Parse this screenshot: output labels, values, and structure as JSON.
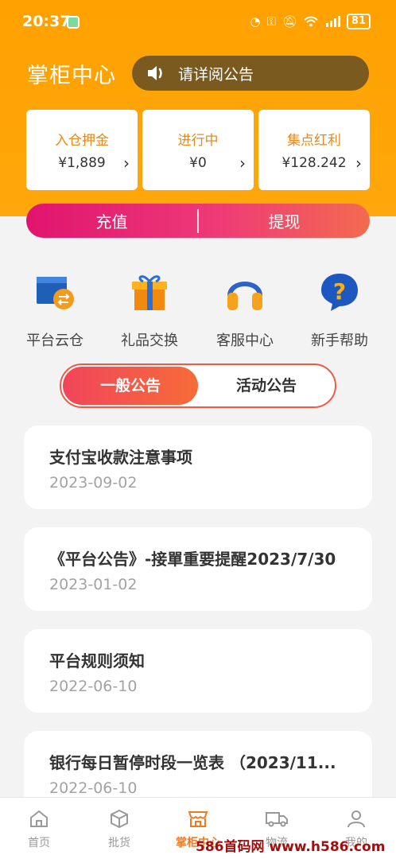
{
  "status_bar": {
    "time": "20:37",
    "battery": "81"
  },
  "header": {
    "title": "掌柜中心",
    "notice_text": "请详阅公告"
  },
  "stats": [
    {
      "label": "入仓押金",
      "value": "¥1,889"
    },
    {
      "label": "进行中",
      "value": "¥0"
    },
    {
      "label": "集点红利",
      "value": "¥128.242"
    }
  ],
  "actions": {
    "recharge": "充值",
    "withdraw": "提现"
  },
  "shortcuts": [
    {
      "label": "平台云仓",
      "icon": "cloud-warehouse-icon"
    },
    {
      "label": "礼品交换",
      "icon": "gift-icon"
    },
    {
      "label": "客服中心",
      "icon": "headphones-icon"
    },
    {
      "label": "新手帮助",
      "icon": "help-icon"
    }
  ],
  "tabs": {
    "general": "一般公告",
    "activity": "活动公告"
  },
  "announcements": [
    {
      "title": "支付宝收款注意事项",
      "date": "2023-09-02"
    },
    {
      "title": "《平台公告》-接單重要提醒2023/7/30",
      "date": "2023-01-02"
    },
    {
      "title": "平台规则须知",
      "date": "2022-06-10"
    },
    {
      "title": "银行每日暂停时段一览表 （2023/11...",
      "date": "2022-06-10"
    }
  ],
  "bottom_nav": [
    {
      "label": "首页",
      "icon": "home-icon"
    },
    {
      "label": "批货",
      "icon": "box-icon"
    },
    {
      "label": "掌柜中心",
      "icon": "store-icon"
    },
    {
      "label": "物流",
      "icon": "truck-icon"
    },
    {
      "label": "我的",
      "icon": "user-icon"
    }
  ],
  "watermark": "586首码网 www.h586.com",
  "colors": {
    "accent": "#ffa100",
    "pink": "#e0146f",
    "tab_active": "#f1455b",
    "nav_active": "#f07a20"
  }
}
